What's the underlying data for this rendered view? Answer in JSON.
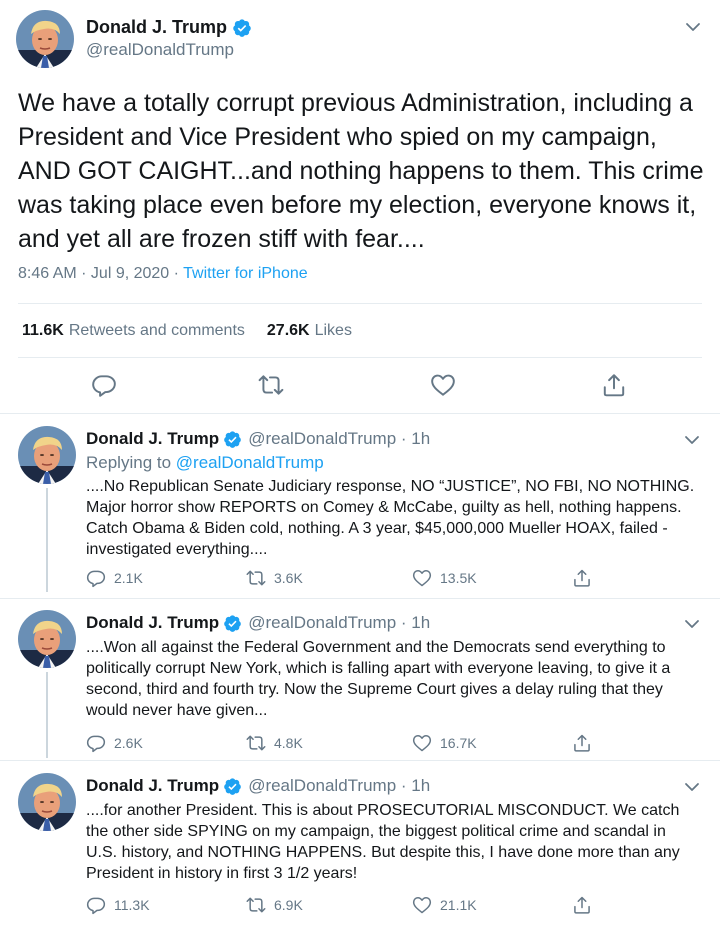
{
  "main": {
    "name": "Donald J. Trump",
    "handle": "@realDonaldTrump",
    "text": "We have a totally corrupt previous Administration, including a President and Vice President who spied on my campaign, AND GOT CAIGHT...and nothing happens to them. This crime was taking place even before my election, everyone knows it, and yet all are frozen stiff with fear....",
    "time": "8:46 AM · Jul 9, 2020 · ",
    "source": "Twitter for iPhone",
    "retweets_count": "11.6K",
    "retweets_label": "Retweets and comments",
    "likes_count": "27.6K",
    "likes_label": "Likes"
  },
  "replies": [
    {
      "name": "Donald J. Trump",
      "handle": "@realDonaldTrump · 1h",
      "replying_prefix": "Replying to ",
      "replying_to": "@realDonaldTrump",
      "text": "....No Republican Senate Judiciary response, NO “JUSTICE”, NO FBI, NO NOTHING. Major horror show REPORTS on Comey & McCabe, guilty as hell, nothing happens. Catch Obama & Biden cold, nothing. A 3 year, $45,000,000 Mueller HOAX, failed - investigated everything....",
      "comments": "2.1K",
      "retweets": "3.6K",
      "likes": "13.5K"
    },
    {
      "name": "Donald J. Trump",
      "handle": "@realDonaldTrump · 1h",
      "text": "....Won all against the Federal Government and the Democrats send everything to politically corrupt New York, which is falling apart with everyone leaving, to give it a second, third and fourth try. Now the Supreme Court gives a  delay ruling that they would never have given...",
      "comments": "2.6K",
      "retweets": "4.8K",
      "likes": "16.7K"
    },
    {
      "name": "Donald J. Trump",
      "handle": "@realDonaldTrump · 1h",
      "text": "....for another President. This is about PROSECUTORIAL MISCONDUCT. We catch the other side SPYING on my campaign, the biggest political crime and scandal in U.S. history, and NOTHING HAPPENS. But despite this, I have done more than any President in history in first 3 1/2 years!",
      "comments": "11.3K",
      "retweets": "6.9K",
      "likes": "21.1K"
    }
  ],
  "icons": {
    "verified": "verified-badge-icon",
    "chevron": "chevron-down-icon",
    "reply": "reply-icon",
    "retweet": "retweet-icon",
    "like": "heart-icon",
    "share": "share-icon"
  },
  "colors": {
    "accent": "#1da1f2",
    "text": "#14171a",
    "muted": "#657786",
    "divider": "#e6ecf0"
  }
}
